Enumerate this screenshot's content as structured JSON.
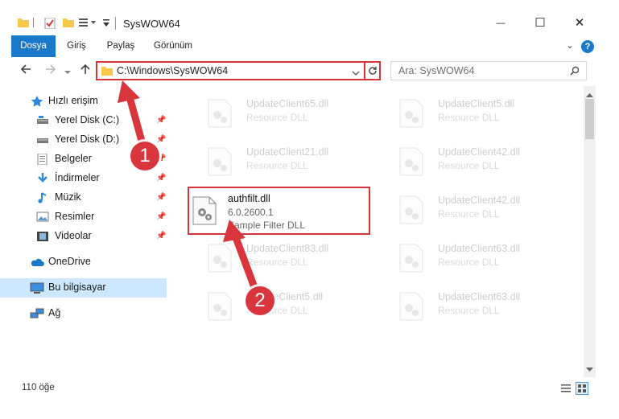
{
  "window": {
    "title": "SysWOW64",
    "minimize_glyph": "—",
    "maximize_glyph": "☐",
    "close_glyph": "✕"
  },
  "ribbon": {
    "tabs": [
      {
        "label": "Dosya",
        "active": true
      },
      {
        "label": "Giriş"
      },
      {
        "label": "Paylaş"
      },
      {
        "label": "Görünüm"
      }
    ],
    "expand_glyph": "⌄",
    "help_glyph": "?"
  },
  "nav": {
    "address": "C:\\Windows\\SysWOW64",
    "search_placeholder": "Ara: SysWOW64"
  },
  "sidebar": {
    "items": [
      {
        "label": "Hızlı erişim",
        "icon": "star-icon",
        "pinned": false
      },
      {
        "label": "Yerel Disk (C:)",
        "icon": "drive-icon",
        "pinned": true
      },
      {
        "label": "Yerel Disk (D:)",
        "icon": "drive-icon",
        "pinned": true
      },
      {
        "label": "Belgeler",
        "icon": "documents-icon",
        "pinned": true
      },
      {
        "label": "İndirmeler",
        "icon": "download-icon",
        "pinned": true
      },
      {
        "label": "Müzik",
        "icon": "music-icon",
        "pinned": true
      },
      {
        "label": "Resimler",
        "icon": "pictures-icon",
        "pinned": true
      },
      {
        "label": "Videolar",
        "icon": "video-icon",
        "pinned": true
      },
      {
        "label": "OneDrive",
        "icon": "cloud-icon",
        "pinned": false
      },
      {
        "label": "Bu bilgisayar",
        "icon": "computer-icon",
        "pinned": false,
        "selected": true
      },
      {
        "label": "Ağ",
        "icon": "network-icon",
        "pinned": false
      }
    ]
  },
  "files": {
    "left": [
      {
        "name": "UpdateClient65.dll",
        "type": "Resource DLL"
      },
      {
        "name": "UpdateClient21.dll",
        "type": "Resource DLL"
      },
      {
        "name": "authfilt.dll",
        "version": "6.0.2600.1",
        "type": "Sample Filter DLL",
        "selected": true
      },
      {
        "name": "UpdateClient83.dll",
        "type": "Resource DLL"
      },
      {
        "name": "UpdateClient5.dll",
        "type": "Resource DLL"
      }
    ],
    "right": [
      {
        "name": "UpdateClient5.dll",
        "type": "Resource DLL"
      },
      {
        "name": "UpdateClient42.dll",
        "type": "Resource DLL"
      },
      {
        "name": "UpdateClient42.dll",
        "type": "Resource DLL"
      },
      {
        "name": "UpdateClient63.dll",
        "type": "Resource DLL"
      },
      {
        "name": "UpdateClient63.dll",
        "type": "Resource DLL"
      }
    ]
  },
  "status": {
    "item_count": "110 öğe"
  },
  "annotations": {
    "step1": "1",
    "step2": "2",
    "color": "#d8363c"
  }
}
